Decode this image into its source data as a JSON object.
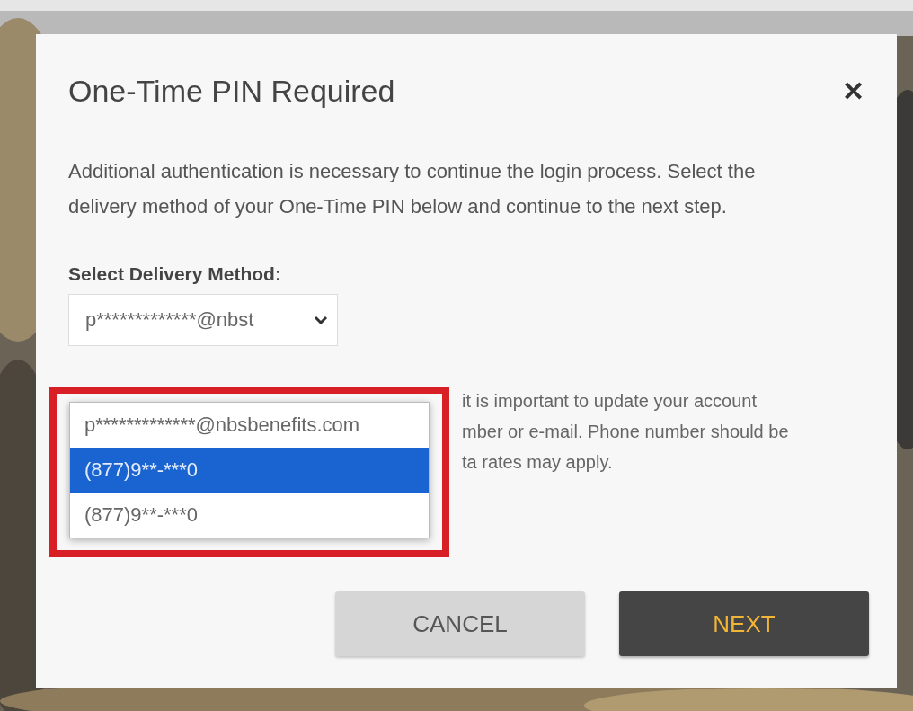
{
  "dialog": {
    "title": "One-Time PIN Required",
    "close": "✕",
    "intro": "Additional authentication is necessary to continue the login process. Select the delivery method of your One-Time PIN below and continue to the next step.",
    "field_label": "Select Delivery Method:",
    "select": {
      "value": "p*************@nbst",
      "expanded": true
    },
    "options": [
      {
        "label": "p*************@nbsbenefits.com",
        "selected": false
      },
      {
        "label": "(877)9**-***0",
        "selected": true
      },
      {
        "label": "(877)9**-***0",
        "selected": false
      }
    ],
    "note_lines": [
      "it is important to update your account",
      "mber or e-mail. Phone number should be",
      "ta rates may apply."
    ],
    "buttons": [
      {
        "label": "CANCEL",
        "kind": "secondary"
      },
      {
        "label": "NEXT",
        "kind": "primary"
      }
    ]
  }
}
